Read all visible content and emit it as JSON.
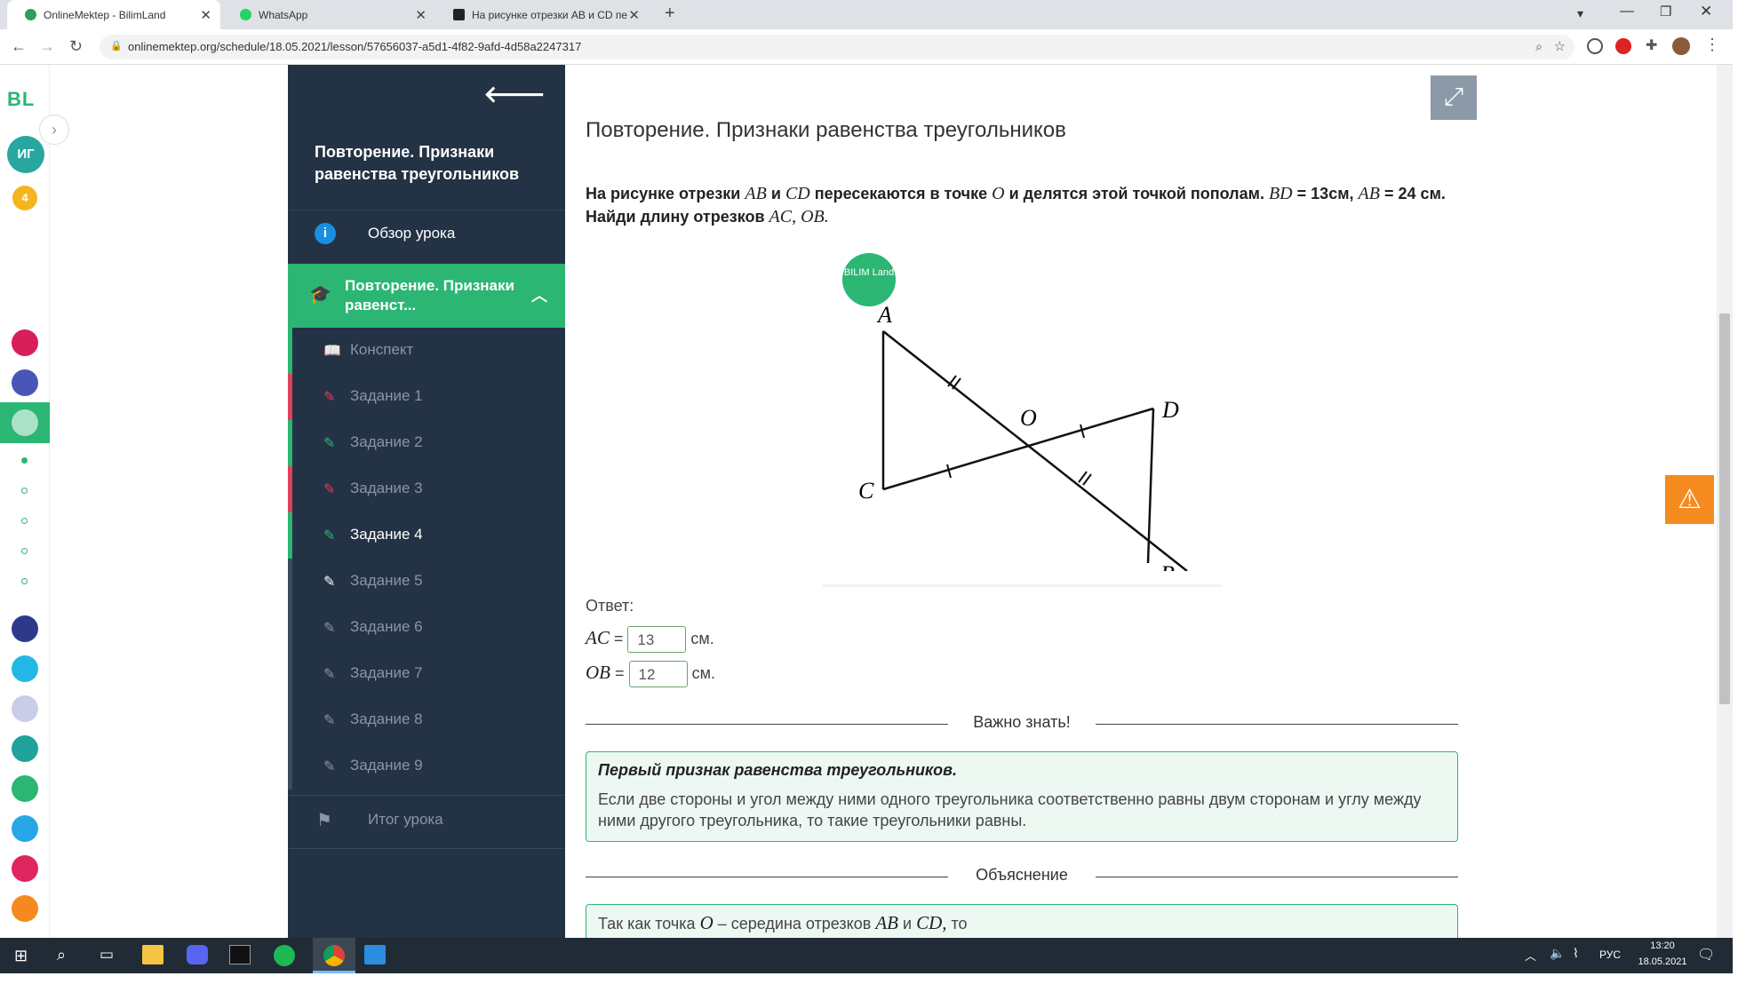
{
  "browser": {
    "tabs": [
      {
        "label": "OnlineMektep - BilimLand",
        "active": true,
        "color": "#2e9e5b"
      },
      {
        "label": "WhatsApp",
        "active": false,
        "color": "#25d366"
      },
      {
        "label": "На рисунке отрезки AB и CD пе",
        "active": false,
        "color": "#222222"
      }
    ],
    "url": "onlinemektep.org/schedule/18.05.2021/lesson/57656037-a5d1-4f82-9afd-4d58a2247317"
  },
  "rail": {
    "logo": "BL",
    "avatar_initials": "ИГ",
    "badge_count": "4"
  },
  "sidebar": {
    "title": "Повторение. Признаки равенства треугольников",
    "overview_label": "Обзор урока",
    "section_label": "Повторение. Признаки равенст...",
    "items": [
      {
        "label": "Конспект",
        "icon": "book-icon",
        "status": "#2e9e5b"
      },
      {
        "label": "Задание 1",
        "icon": "edit-icon",
        "status": "#e0405a"
      },
      {
        "label": "Задание 2",
        "icon": "edit-icon",
        "status": "#2e9e5b"
      },
      {
        "label": "Задание 3",
        "icon": "edit-icon",
        "status": "#e0405a"
      },
      {
        "label": "Задание 4",
        "icon": "edit-icon",
        "status": "#2e9e5b"
      },
      {
        "label": "Задание 5",
        "icon": "edit-icon",
        "status": ""
      },
      {
        "label": "Задание 6",
        "icon": "edit-icon",
        "status": ""
      },
      {
        "label": "Задание 7",
        "icon": "edit-icon",
        "status": ""
      },
      {
        "label": "Задание 8",
        "icon": "edit-icon",
        "status": ""
      },
      {
        "label": "Задание 9",
        "icon": "edit-icon",
        "status": ""
      }
    ],
    "summary_label": "Итог урока"
  },
  "main": {
    "page_title": "Повторение. Признаки равенства треугольников",
    "task_text_1": "На рисунке отрезки",
    "task_ab": "AB",
    "task_and": "и",
    "task_cd": "CD",
    "task_text_2": "пересекаются в точке",
    "task_o": "O",
    "task_text_3": "и делятся этой точкой пополам.",
    "task_bd": "BD",
    "task_bd_val": "= 13см,",
    "task_ab2": "AB",
    "task_ab_val": "=",
    "task_text_4": "24 см. Найди длину отрезков",
    "task_ac_ob": "AC, OB.",
    "figure_badge": "BILIM Land",
    "points": {
      "A": "A",
      "B": "B",
      "C": "C",
      "D": "D",
      "O": "O"
    },
    "answer_label": "Ответ:",
    "answers": [
      {
        "var": "AC",
        "eq": "=",
        "value": "13",
        "unit": "см."
      },
      {
        "var": "OB",
        "eq": "=",
        "value": "12",
        "unit": "см."
      }
    ],
    "important_heading": "Важно знать!",
    "rule_title": "Первый признак равенства треугольников.",
    "rule_text": "Если две стороны и угол между ними одного треугольника соответственно равны двум сторонам и углу между ними другого треугольника, то такие треугольники равны.",
    "explanation_heading": "Объяснение",
    "explanation_text_1": "Так как точка",
    "explanation_o": "O",
    "explanation_text_2": "– середина отрезков",
    "explanation_ab": "AB",
    "explanation_and": "и",
    "explanation_cd": "CD,",
    "explanation_text_3": "то"
  },
  "taskbar": {
    "lang": "РУС",
    "time": "13:20",
    "date": "18.05.2021"
  }
}
